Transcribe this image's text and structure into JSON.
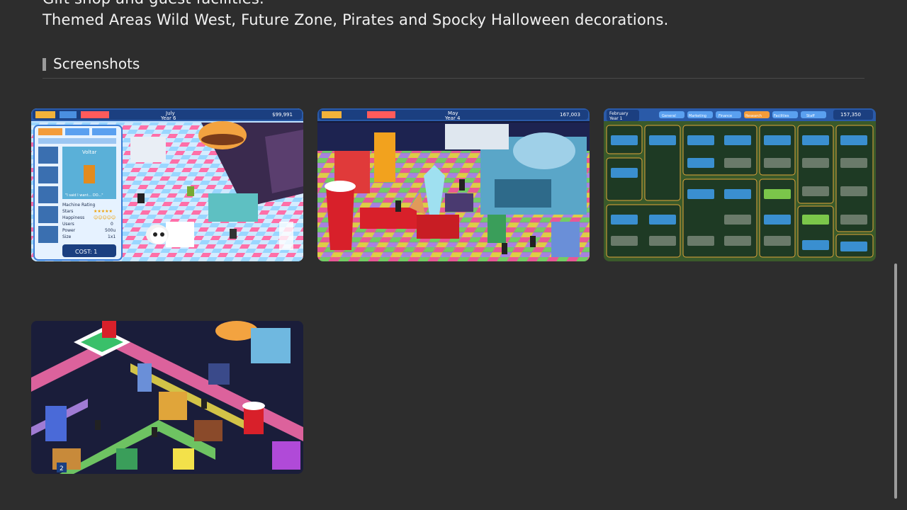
{
  "description": {
    "cut_line": "Gift shop and guest facilities.",
    "line": "Themed Areas Wild West, Future Zone, Pirates and Spocky Halloween decorations."
  },
  "screenshots_section": {
    "title": "Screenshots"
  },
  "screenshots": [
    {
      "hud_month": "July",
      "hud_year": "Year 6",
      "hud_money": "$99,991",
      "panel_name": "Voltar",
      "panel_quote": "\"I said I want... DO...\"",
      "rating_label": "Machine Rating",
      "stats": [
        {
          "label": "Stars",
          "value": "★★★★★"
        },
        {
          "label": "Happiness",
          "value": "☺☺☺☺☺"
        },
        {
          "label": "Users",
          "value": "0"
        },
        {
          "label": "Power",
          "value": "500u"
        },
        {
          "label": "Size",
          "value": "1x1"
        }
      ],
      "cost": "COST: 1"
    },
    {
      "hud_month": "May",
      "hud_year": "Year 4",
      "hud_money": "167,003"
    },
    {
      "hud_month": "February",
      "hud_year": "Year 1",
      "hud_money": "157,350",
      "tabs": [
        "General",
        "Marketing",
        "Finance",
        "Research",
        "Facilities",
        "Staff"
      ]
    },
    {
      "badge": "2"
    }
  ],
  "colors": {
    "background": "#2d2d2d",
    "divider": "#4a4a4a",
    "scrollbar": "#9b9b9b"
  }
}
